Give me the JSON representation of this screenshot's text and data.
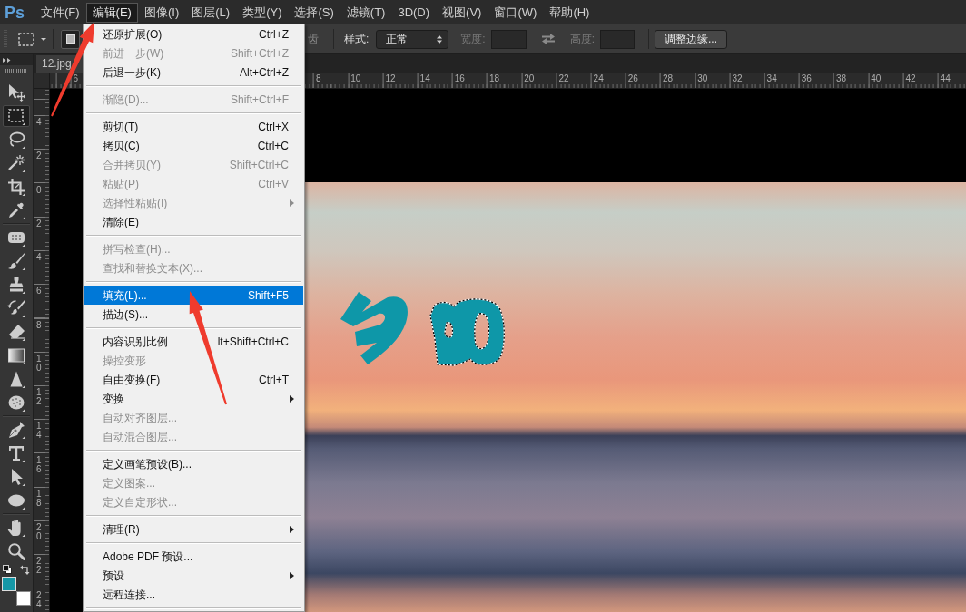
{
  "app": {
    "logo": "Ps"
  },
  "menu_bar": [
    {
      "label": "文件(F)",
      "selected": false
    },
    {
      "label": "编辑(E)",
      "selected": true
    },
    {
      "label": "图像(I)",
      "selected": false
    },
    {
      "label": "图层(L)",
      "selected": false
    },
    {
      "label": "类型(Y)",
      "selected": false
    },
    {
      "label": "选择(S)",
      "selected": false
    },
    {
      "label": "滤镜(T)",
      "selected": false
    },
    {
      "label": "3D(D)",
      "selected": false
    },
    {
      "label": "视图(V)",
      "selected": false
    },
    {
      "label": "窗口(W)",
      "selected": false
    },
    {
      "label": "帮助(H)",
      "selected": false
    }
  ],
  "options_bar": {
    "mode_buttons": [
      {
        "selected": true
      }
    ],
    "antialias_label": "齿",
    "style": {
      "label": "样式:",
      "value": "正常"
    },
    "width": {
      "label": "宽度:",
      "disabled": true
    },
    "height": {
      "label": "高度:",
      "disabled": true
    },
    "refine_edge_button": "调整边缘..."
  },
  "toolbar": {
    "groups": [
      [
        {
          "kind": "move",
          "selected": false
        },
        {
          "kind": "marquee",
          "selected": true
        },
        {
          "kind": "lasso",
          "selected": false
        },
        {
          "kind": "magic_wand",
          "selected": false
        },
        {
          "kind": "crop",
          "selected": false
        },
        {
          "kind": "eyedropper",
          "selected": false
        }
      ],
      [
        {
          "kind": "healing",
          "selected": false
        },
        {
          "kind": "brush",
          "selected": false
        },
        {
          "kind": "stamp",
          "selected": false
        },
        {
          "kind": "history_brush",
          "selected": false
        },
        {
          "kind": "eraser",
          "selected": false
        },
        {
          "kind": "gradient",
          "selected": false
        },
        {
          "kind": "sharpen",
          "selected": false
        },
        {
          "kind": "sponge",
          "selected": false
        }
      ],
      [
        {
          "kind": "pen",
          "selected": false
        },
        {
          "kind": "type",
          "selected": false
        },
        {
          "kind": "path_select",
          "selected": false
        },
        {
          "kind": "ellipse",
          "selected": false
        }
      ],
      [
        {
          "kind": "hand",
          "selected": false
        },
        {
          "kind": "zoom",
          "selected": false
        }
      ]
    ],
    "color_swatches": [
      {
        "color": "#1597a6"
      },
      {
        "color": "#ffffff"
      }
    ]
  },
  "document_tab": {
    "title": "12.jpg"
  },
  "rulers": {
    "horizontal": [
      "6",
      "8",
      "10",
      "12",
      "14",
      "16",
      "18",
      "20",
      "22",
      "24",
      "26",
      "28",
      "30",
      "32",
      "34",
      "36",
      "38",
      "40",
      "42",
      "44"
    ],
    "vertical": [
      "4",
      "2",
      "0",
      "2",
      "4",
      "6",
      "8",
      "10",
      "12",
      "14",
      "16",
      "18",
      "20",
      "22",
      "24"
    ]
  },
  "edit_menu": [
    {
      "kind": "item",
      "label": "还原扩展(O)",
      "shortcut": "Ctrl+Z",
      "disabled": false,
      "selected": false,
      "submenu": false
    },
    {
      "kind": "item",
      "label": "前进一步(W)",
      "shortcut": "Shift+Ctrl+Z",
      "disabled": true,
      "selected": false,
      "submenu": false
    },
    {
      "kind": "item",
      "label": "后退一步(K)",
      "shortcut": "Alt+Ctrl+Z",
      "disabled": false,
      "selected": false,
      "submenu": false
    },
    {
      "kind": "separator"
    },
    {
      "kind": "item",
      "label": "渐隐(D)...",
      "shortcut": "Shift+Ctrl+F",
      "disabled": true,
      "selected": false,
      "submenu": false
    },
    {
      "kind": "separator"
    },
    {
      "kind": "item",
      "label": "剪切(T)",
      "shortcut": "Ctrl+X",
      "disabled": false,
      "selected": false,
      "submenu": false
    },
    {
      "kind": "item",
      "label": "拷贝(C)",
      "shortcut": "Ctrl+C",
      "disabled": false,
      "selected": false,
      "submenu": false
    },
    {
      "kind": "item",
      "label": "合并拷贝(Y)",
      "shortcut": "Shift+Ctrl+C",
      "disabled": true,
      "selected": false,
      "submenu": false
    },
    {
      "kind": "item",
      "label": "粘贴(P)",
      "shortcut": "Ctrl+V",
      "disabled": true,
      "selected": false,
      "submenu": false
    },
    {
      "kind": "item",
      "label": "选择性粘贴(I)",
      "disabled": true,
      "selected": false,
      "submenu": true
    },
    {
      "kind": "item",
      "label": "清除(E)",
      "disabled": false,
      "selected": false,
      "submenu": false
    },
    {
      "kind": "separator"
    },
    {
      "kind": "item",
      "label": "拼写检查(H)...",
      "disabled": true,
      "selected": false,
      "submenu": false
    },
    {
      "kind": "item",
      "label": "查找和替换文本(X)...",
      "disabled": true,
      "selected": false,
      "submenu": false
    },
    {
      "kind": "separator"
    },
    {
      "kind": "item",
      "label": "填充(L)...",
      "shortcut": "Shift+F5",
      "disabled": false,
      "selected": true,
      "submenu": false
    },
    {
      "kind": "item",
      "label": "描边(S)...",
      "disabled": false,
      "selected": false,
      "submenu": false
    },
    {
      "kind": "separator"
    },
    {
      "kind": "item",
      "label": "内容识别比例",
      "shortcut": "lt+Shift+Ctrl+C",
      "disabled": false,
      "selected": false,
      "submenu": false
    },
    {
      "kind": "item",
      "label": "操控变形",
      "disabled": true,
      "selected": false,
      "submenu": false
    },
    {
      "kind": "item",
      "label": "自由变换(F)",
      "shortcut": "Ctrl+T",
      "disabled": false,
      "selected": false,
      "submenu": false
    },
    {
      "kind": "item",
      "label": "变换",
      "disabled": false,
      "selected": false,
      "submenu": true
    },
    {
      "kind": "item",
      "label": "自动对齐图层...",
      "disabled": true,
      "selected": false,
      "submenu": false
    },
    {
      "kind": "item",
      "label": "自动混合图层...",
      "disabled": true,
      "selected": false,
      "submenu": false
    },
    {
      "kind": "separator"
    },
    {
      "kind": "item",
      "label": "定义画笔预设(B)...",
      "disabled": false,
      "selected": false,
      "submenu": false
    },
    {
      "kind": "item",
      "label": "定义图案...",
      "disabled": true,
      "selected": false,
      "submenu": false
    },
    {
      "kind": "item",
      "label": "定义自定形状...",
      "disabled": true,
      "selected": false,
      "submenu": false
    },
    {
      "kind": "separator"
    },
    {
      "kind": "item",
      "label": "清理(R)",
      "disabled": false,
      "selected": false,
      "submenu": true
    },
    {
      "kind": "separator"
    },
    {
      "kind": "item",
      "label": "Adobe PDF 预设...",
      "disabled": false,
      "selected": false,
      "submenu": false
    },
    {
      "kind": "item",
      "label": "预设",
      "disabled": false,
      "selected": false,
      "submenu": true
    },
    {
      "kind": "item",
      "label": "远程连接...",
      "disabled": false,
      "selected": false,
      "submenu": false
    },
    {
      "kind": "separator"
    }
  ]
}
